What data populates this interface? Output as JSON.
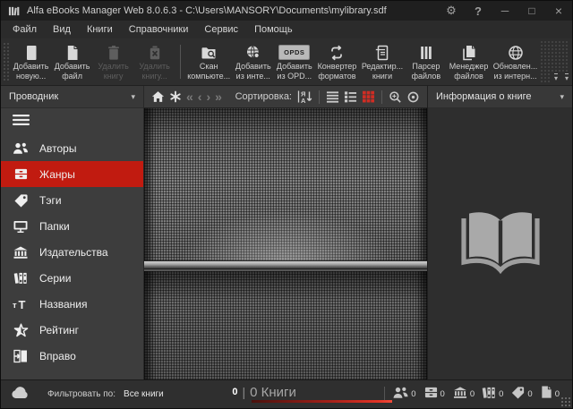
{
  "window": {
    "title": "Alfa eBooks Manager Web 8.0.6.3 - C:\\Users\\MANSORY\\Documents\\mylibrary.sdf"
  },
  "menu": {
    "items": [
      {
        "label": "Файл"
      },
      {
        "label": "Вид"
      },
      {
        "label": "Книги"
      },
      {
        "label": "Справочники"
      },
      {
        "label": "Сервис"
      },
      {
        "label": "Помощь"
      }
    ]
  },
  "toolbar": {
    "buttons": [
      {
        "line1": "Добавить",
        "line2": "новую...",
        "enabled": true
      },
      {
        "line1": "Добавить",
        "line2": "файл",
        "enabled": true
      },
      {
        "line1": "Удалить",
        "line2": "книгу",
        "enabled": false
      },
      {
        "line1": "Удалить",
        "line2": "книгу...",
        "enabled": false
      },
      {
        "line1": "Скан",
        "line2": "компьюте...",
        "enabled": true
      },
      {
        "line1": "Добавить",
        "line2": "из инте...",
        "enabled": true
      },
      {
        "line1": "Добавить",
        "line2": "из OPD...",
        "enabled": true,
        "badge": "OPDS"
      },
      {
        "line1": "Конвертер",
        "line2": "форматов",
        "enabled": true
      },
      {
        "line1": "Редактир...",
        "line2": "книги",
        "enabled": true
      },
      {
        "line1": "Парсер",
        "line2": "файлов",
        "enabled": true
      },
      {
        "line1": "Менеджер",
        "line2": "файлов",
        "enabled": true
      },
      {
        "line1": "Обновлен...",
        "line2": "из интерн...",
        "enabled": true
      }
    ]
  },
  "explorer": {
    "header": "Проводник",
    "items": [
      {
        "label": "Авторы",
        "selected": false
      },
      {
        "label": "Жанры",
        "selected": true
      },
      {
        "label": "Тэги",
        "selected": false
      },
      {
        "label": "Папки",
        "selected": false
      },
      {
        "label": "Издательства",
        "selected": false
      },
      {
        "label": "Серии",
        "selected": false
      },
      {
        "label": "Названия",
        "selected": false
      },
      {
        "label": "Рейтинг",
        "selected": false
      },
      {
        "label": "Вправо",
        "selected": false
      }
    ]
  },
  "browser": {
    "sort_label": "Сортировка:"
  },
  "info": {
    "header": "Информация о книге"
  },
  "statusbar": {
    "filter_label": "Фильтровать по:",
    "filter_value": "Все книги",
    "selected_count": "0",
    "total_count": "0 Книги",
    "counters": [
      {
        "name": "authors",
        "value": "0"
      },
      {
        "name": "genres",
        "value": "0"
      },
      {
        "name": "publishers",
        "value": "0"
      },
      {
        "name": "series",
        "value": "0"
      },
      {
        "name": "tags",
        "value": "0"
      },
      {
        "name": "books",
        "value": "0"
      }
    ]
  },
  "colors": {
    "accent_red": "#c11b10",
    "grid_active_red": "#cf2d24",
    "progress_red": "#e23325",
    "sidebar_bg": "#3d3d3d",
    "panel_bg": "#2e2e2e",
    "titlebar_bg": "#1f1f1f"
  }
}
